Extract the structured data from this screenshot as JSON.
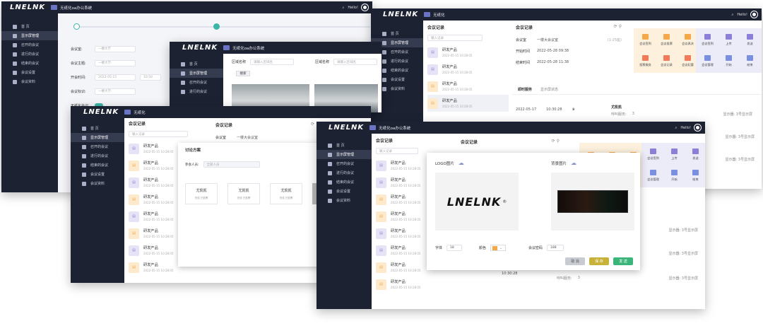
{
  "brand": {
    "logo_text": "LNELNK",
    "system_title": "无纸化oa办公系统",
    "system_title_short": "无纸化"
  },
  "user": {
    "name": "Hello!"
  },
  "menu": [
    "首 页",
    "显示屏管理",
    "召开的会议",
    "进行的会议",
    "结束的会议",
    "会议设置",
    "会议资料"
  ],
  "form_a": {
    "labels": [
      "会议室:",
      "会议主题:",
      "开会时间:",
      "会议标识:",
      "无纸化会议:"
    ],
    "placeholders": [
      "一楼大厅",
      "一楼大厅",
      "2022-05-15",
      "10:50",
      "一楼大厅"
    ]
  },
  "room_filter": {
    "label1": "区域名称",
    "placeholder1": "请输入区域名",
    "label2": "区域名称",
    "placeholder2": "请输入区域名",
    "button": "搜索"
  },
  "meeting_list": {
    "title": "会议记录",
    "search_placeholder": "输入记录",
    "item_title": "研发产品",
    "item_date": "2022-05-15",
    "item_time": "10:28:05"
  },
  "meeting_detail": {
    "title": "会议记录",
    "rows": [
      {
        "k": "会议室",
        "v": "一楼大会议室",
        "extra": "(1-25座)"
      },
      {
        "k": "开始时间",
        "v": "2022-05-28   09:38",
        "extra": ""
      },
      {
        "k": "结束时间",
        "v": "2022-05-28   11:38",
        "extra": ""
      }
    ],
    "tabs": [
      "即时服务",
      "显示屏状态"
    ],
    "service_date": "2022-05-17",
    "service_time": "10:30:28",
    "staff_name": "尤凯凯",
    "staff_label": "呼叫服务:",
    "staff_count": "3",
    "staff_note": "显示器: 3号显示屏"
  },
  "tiles_warm": [
    "会议签到",
    "会议投票",
    "会议表决",
    "投票服务",
    "会议记录",
    "会议纪要"
  ],
  "tiles_cool": [
    "会议签到",
    "上传",
    "发送",
    "会议管理",
    "开始",
    "结束"
  ],
  "discussion": {
    "title": "讨论方案",
    "participant_label": "参会人员:",
    "participant_placeholder": "全部人员",
    "cards": [
      {
        "name": "尤凯凯",
        "sub": "在线  已投票"
      },
      {
        "name": "尤凯凯",
        "sub": "在线  已投票"
      },
      {
        "name": "尤凯凯",
        "sub": "在线  已投票"
      }
    ]
  },
  "upload_dialog": {
    "logo_label": "LOGO图片",
    "bg_label": "背景图片",
    "font_label": "字体",
    "font_value": "18",
    "color_label": "颜色",
    "pwd_label": "会议密码",
    "pwd_value": "188",
    "buttons": [
      "取 消",
      "保 存",
      "发 送"
    ]
  },
  "colors": {
    "dark": "#1d2233",
    "accent": "#6a74c4",
    "orange": "#f5a84a",
    "purple": "#8b7fd8",
    "green": "#3bb57a",
    "gold": "#c8b23a"
  }
}
